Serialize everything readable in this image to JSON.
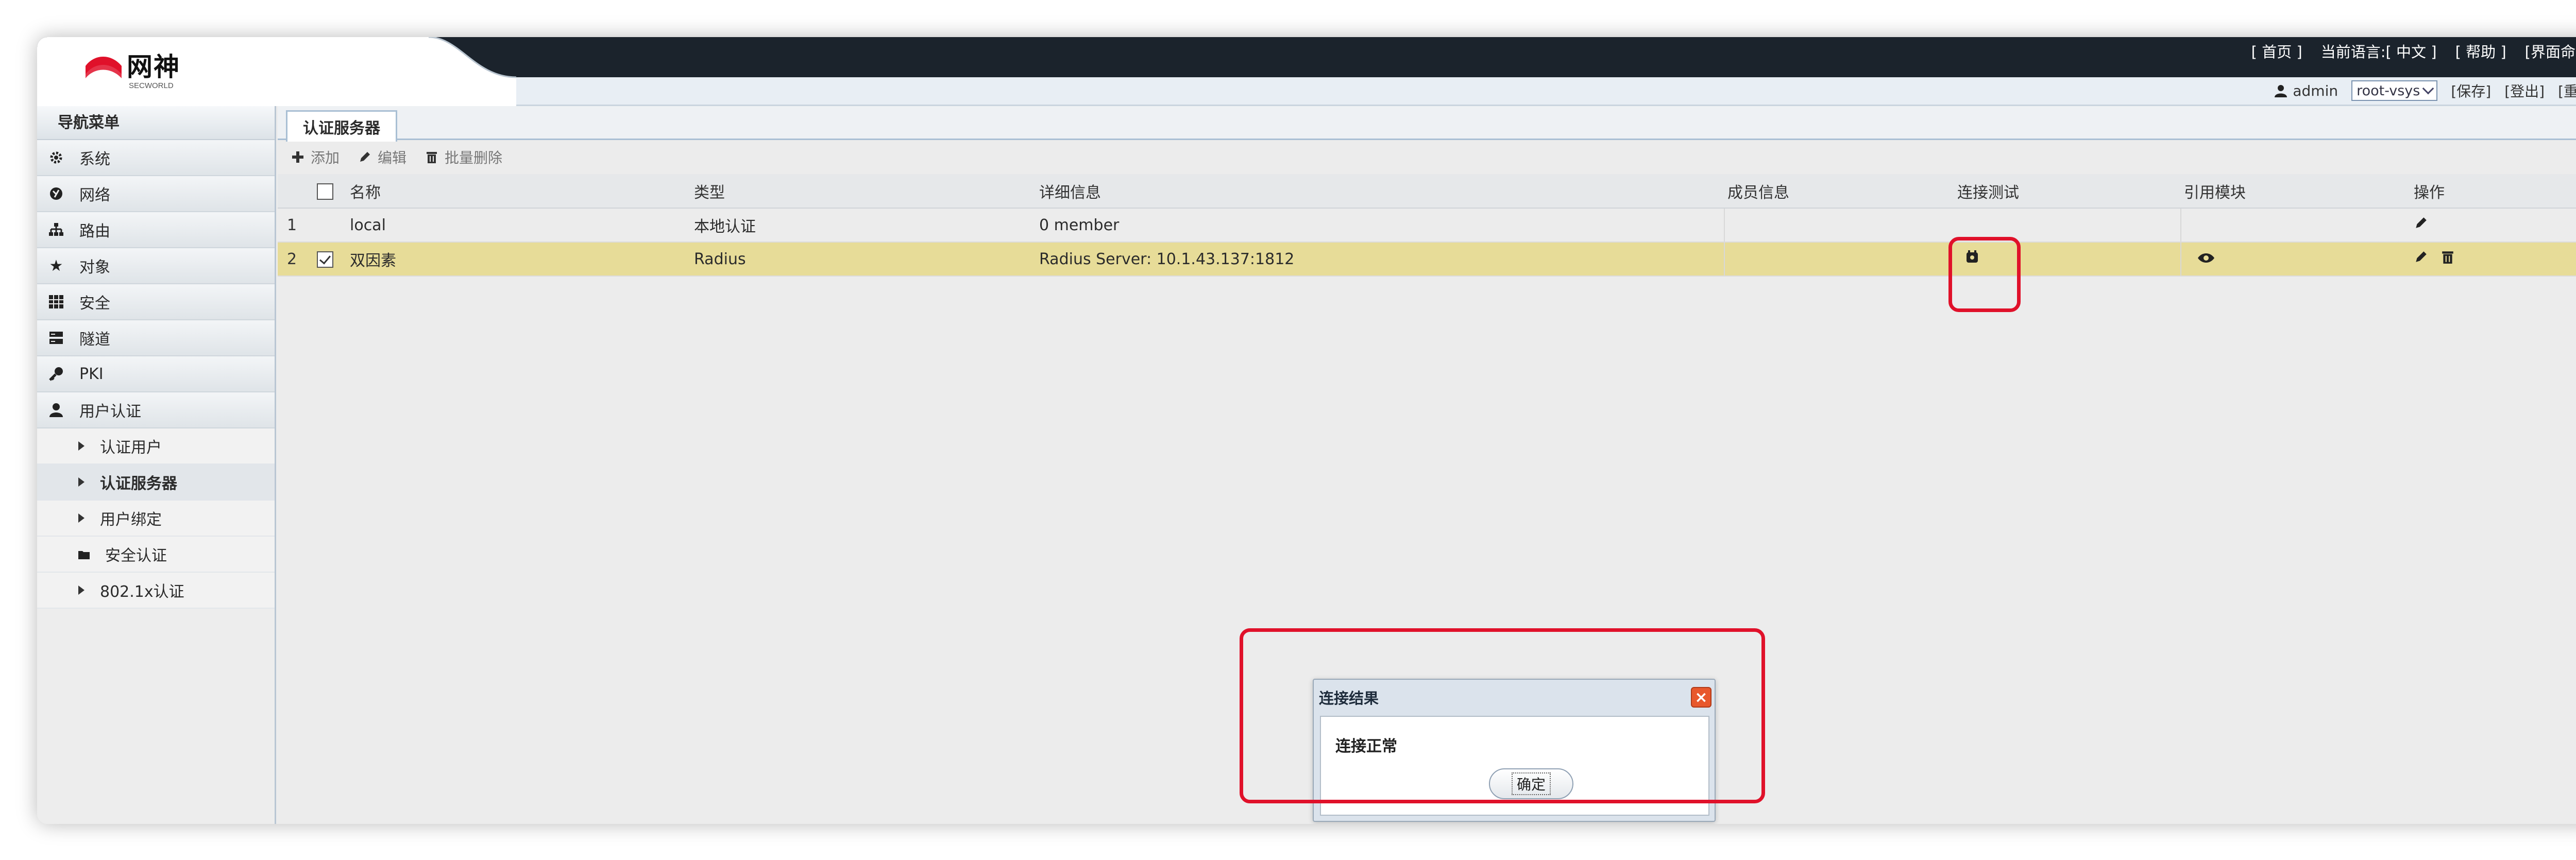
{
  "brand": {
    "name": "网神",
    "sub": "SECWORLD",
    "accent": "#e0112a"
  },
  "header": {
    "links": [
      "[ 首页 ]",
      "当前语言:[ 中文 ]",
      "[ 帮助 ]",
      "[界面命令"
    ],
    "user": "admin",
    "vsys": "root-vsys",
    "actions": [
      "[保存]",
      "[登出]",
      "[重启"
    ]
  },
  "sidebar": {
    "title": "导航菜单",
    "items": [
      {
        "label": "系统",
        "icon": "gear-icon"
      },
      {
        "label": "网络",
        "icon": "globe-icon"
      },
      {
        "label": "路由",
        "icon": "sitemap-icon"
      },
      {
        "label": "对象",
        "icon": "star-icon"
      },
      {
        "label": "安全",
        "icon": "grid-icon"
      },
      {
        "label": "隧道",
        "icon": "server-icon"
      },
      {
        "label": "PKI",
        "icon": "key-icon"
      },
      {
        "label": "用户认证",
        "icon": "user-icon"
      }
    ],
    "subitems": [
      {
        "label": "认证用户"
      },
      {
        "label": "认证服务器"
      },
      {
        "label": "用户绑定"
      },
      {
        "label": "安全认证"
      },
      {
        "label": "802.1x认证"
      }
    ]
  },
  "tab": {
    "label": "认证服务器"
  },
  "toolbar": {
    "add": "添加",
    "edit": "编辑",
    "batch_delete": "批量删除"
  },
  "table": {
    "headers": [
      "名称",
      "类型",
      "详细信息",
      "成员信息",
      "连接测试",
      "引用模块",
      "操作"
    ],
    "rows": [
      {
        "num": "1",
        "name": "local",
        "type": "本地认证",
        "detail": "0 member"
      },
      {
        "num": "2",
        "name": "双因素",
        "type": "Radius",
        "detail": "Radius Server: 10.1.43.137:1812"
      }
    ]
  },
  "dialog": {
    "title": "连接结果",
    "message": "连接正常",
    "ok": "确定"
  }
}
